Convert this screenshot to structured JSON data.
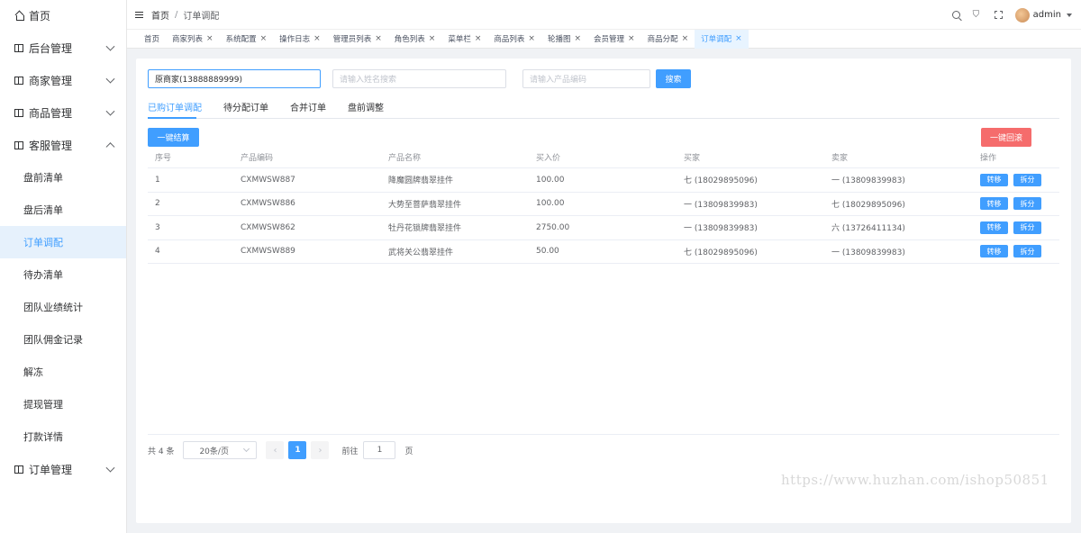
{
  "sidebar": {
    "items": [
      {
        "label": "首页",
        "icon": "home-icon"
      },
      {
        "label": "后台管理",
        "icon": "book-icon",
        "expandable": true
      },
      {
        "label": "商家管理",
        "icon": "book-icon",
        "expandable": true
      },
      {
        "label": "商品管理",
        "icon": "book-icon",
        "expandable": true
      },
      {
        "label": "客服管理",
        "icon": "book-icon",
        "expanded": true
      },
      {
        "label": "订单管理",
        "icon": "book-icon",
        "expandable": true
      }
    ],
    "sub_items": [
      "盘前清单",
      "盘后清单",
      "订单调配",
      "待办清单",
      "团队业绩统计",
      "团队佣金记录",
      "解冻",
      "提现管理",
      "打款详情"
    ],
    "active_sub": "订单调配"
  },
  "header": {
    "breadcrumb_home": "首页",
    "breadcrumb_sep": "/",
    "breadcrumb_current": "订单调配",
    "username": "admin"
  },
  "tags": [
    "首页",
    "商家列表",
    "系统配置",
    "操作日志",
    "管理员列表",
    "角色列表",
    "菜单栏",
    "商品列表",
    "轮播图",
    "会员管理",
    "商品分配",
    "订单调配"
  ],
  "active_tag": "订单调配",
  "filters": {
    "merchant_value": "原商家(13888889999)",
    "name_placeholder": "请输入姓名搜索",
    "code_placeholder": "请输入产品编码",
    "search_label": "搜索"
  },
  "tabs": [
    "已购订单调配",
    "待分配订单",
    "合并订单",
    "盘前调整"
  ],
  "actions": {
    "settle_label": "一键结算",
    "rollback_label": "一键回滚"
  },
  "table": {
    "headers": [
      "序号",
      "产品编码",
      "产品名称",
      "买入价",
      "买家",
      "卖家",
      "操作"
    ],
    "rows": [
      [
        "1",
        "CXMWSW887",
        "降魔圆牌翡翠挂件",
        "100.00",
        "七 (18029895096)",
        "一 (13809839983)"
      ],
      [
        "2",
        "CXMWSW886",
        "大势至菩萨翡翠挂件",
        "100.00",
        "一 (13809839983)",
        "七 (18029895096)"
      ],
      [
        "3",
        "CXMWSW862",
        "牡丹花锁牌翡翠挂件",
        "2750.00",
        "一 (13809839983)",
        "六 (13726411134)"
      ],
      [
        "4",
        "CXMWSW889",
        "武将关公翡翠挂件",
        "50.00",
        "七 (18029895096)",
        "一 (13809839983)"
      ]
    ],
    "row_actions": [
      "转移",
      "拆分"
    ]
  },
  "pagination": {
    "total_text": "共 4 条",
    "page_size": "20条/页",
    "current_page": "1",
    "goto_label": "前往",
    "goto_value": "1",
    "page_suffix": "页"
  },
  "watermark": "https://www.huzhan.com/ishop50851"
}
